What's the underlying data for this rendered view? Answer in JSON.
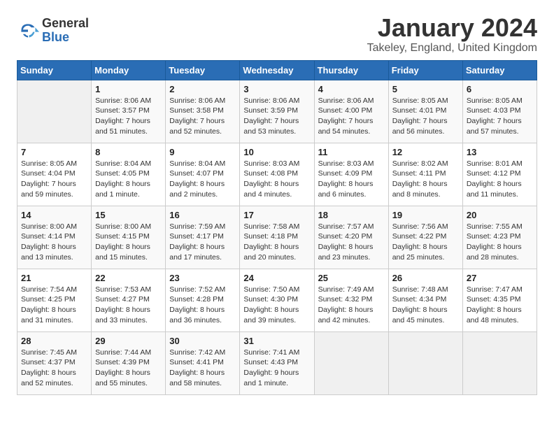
{
  "header": {
    "logo_general": "General",
    "logo_blue": "Blue",
    "title": "January 2024",
    "subtitle": "Takeley, England, United Kingdom"
  },
  "days_of_week": [
    "Sunday",
    "Monday",
    "Tuesday",
    "Wednesday",
    "Thursday",
    "Friday",
    "Saturday"
  ],
  "weeks": [
    [
      {
        "day": "",
        "info": ""
      },
      {
        "day": "1",
        "info": "Sunrise: 8:06 AM\nSunset: 3:57 PM\nDaylight: 7 hours\nand 51 minutes."
      },
      {
        "day": "2",
        "info": "Sunrise: 8:06 AM\nSunset: 3:58 PM\nDaylight: 7 hours\nand 52 minutes."
      },
      {
        "day": "3",
        "info": "Sunrise: 8:06 AM\nSunset: 3:59 PM\nDaylight: 7 hours\nand 53 minutes."
      },
      {
        "day": "4",
        "info": "Sunrise: 8:06 AM\nSunset: 4:00 PM\nDaylight: 7 hours\nand 54 minutes."
      },
      {
        "day": "5",
        "info": "Sunrise: 8:05 AM\nSunset: 4:01 PM\nDaylight: 7 hours\nand 56 minutes."
      },
      {
        "day": "6",
        "info": "Sunrise: 8:05 AM\nSunset: 4:03 PM\nDaylight: 7 hours\nand 57 minutes."
      }
    ],
    [
      {
        "day": "7",
        "info": "Sunrise: 8:05 AM\nSunset: 4:04 PM\nDaylight: 7 hours\nand 59 minutes."
      },
      {
        "day": "8",
        "info": "Sunrise: 8:04 AM\nSunset: 4:05 PM\nDaylight: 8 hours\nand 1 minute."
      },
      {
        "day": "9",
        "info": "Sunrise: 8:04 AM\nSunset: 4:07 PM\nDaylight: 8 hours\nand 2 minutes."
      },
      {
        "day": "10",
        "info": "Sunrise: 8:03 AM\nSunset: 4:08 PM\nDaylight: 8 hours\nand 4 minutes."
      },
      {
        "day": "11",
        "info": "Sunrise: 8:03 AM\nSunset: 4:09 PM\nDaylight: 8 hours\nand 6 minutes."
      },
      {
        "day": "12",
        "info": "Sunrise: 8:02 AM\nSunset: 4:11 PM\nDaylight: 8 hours\nand 8 minutes."
      },
      {
        "day": "13",
        "info": "Sunrise: 8:01 AM\nSunset: 4:12 PM\nDaylight: 8 hours\nand 11 minutes."
      }
    ],
    [
      {
        "day": "14",
        "info": "Sunrise: 8:00 AM\nSunset: 4:14 PM\nDaylight: 8 hours\nand 13 minutes."
      },
      {
        "day": "15",
        "info": "Sunrise: 8:00 AM\nSunset: 4:15 PM\nDaylight: 8 hours\nand 15 minutes."
      },
      {
        "day": "16",
        "info": "Sunrise: 7:59 AM\nSunset: 4:17 PM\nDaylight: 8 hours\nand 17 minutes."
      },
      {
        "day": "17",
        "info": "Sunrise: 7:58 AM\nSunset: 4:18 PM\nDaylight: 8 hours\nand 20 minutes."
      },
      {
        "day": "18",
        "info": "Sunrise: 7:57 AM\nSunset: 4:20 PM\nDaylight: 8 hours\nand 23 minutes."
      },
      {
        "day": "19",
        "info": "Sunrise: 7:56 AM\nSunset: 4:22 PM\nDaylight: 8 hours\nand 25 minutes."
      },
      {
        "day": "20",
        "info": "Sunrise: 7:55 AM\nSunset: 4:23 PM\nDaylight: 8 hours\nand 28 minutes."
      }
    ],
    [
      {
        "day": "21",
        "info": "Sunrise: 7:54 AM\nSunset: 4:25 PM\nDaylight: 8 hours\nand 31 minutes."
      },
      {
        "day": "22",
        "info": "Sunrise: 7:53 AM\nSunset: 4:27 PM\nDaylight: 8 hours\nand 33 minutes."
      },
      {
        "day": "23",
        "info": "Sunrise: 7:52 AM\nSunset: 4:28 PM\nDaylight: 8 hours\nand 36 minutes."
      },
      {
        "day": "24",
        "info": "Sunrise: 7:50 AM\nSunset: 4:30 PM\nDaylight: 8 hours\nand 39 minutes."
      },
      {
        "day": "25",
        "info": "Sunrise: 7:49 AM\nSunset: 4:32 PM\nDaylight: 8 hours\nand 42 minutes."
      },
      {
        "day": "26",
        "info": "Sunrise: 7:48 AM\nSunset: 4:34 PM\nDaylight: 8 hours\nand 45 minutes."
      },
      {
        "day": "27",
        "info": "Sunrise: 7:47 AM\nSunset: 4:35 PM\nDaylight: 8 hours\nand 48 minutes."
      }
    ],
    [
      {
        "day": "28",
        "info": "Sunrise: 7:45 AM\nSunset: 4:37 PM\nDaylight: 8 hours\nand 52 minutes."
      },
      {
        "day": "29",
        "info": "Sunrise: 7:44 AM\nSunset: 4:39 PM\nDaylight: 8 hours\nand 55 minutes."
      },
      {
        "day": "30",
        "info": "Sunrise: 7:42 AM\nSunset: 4:41 PM\nDaylight: 8 hours\nand 58 minutes."
      },
      {
        "day": "31",
        "info": "Sunrise: 7:41 AM\nSunset: 4:43 PM\nDaylight: 9 hours\nand 1 minute."
      },
      {
        "day": "",
        "info": ""
      },
      {
        "day": "",
        "info": ""
      },
      {
        "day": "",
        "info": ""
      }
    ]
  ]
}
